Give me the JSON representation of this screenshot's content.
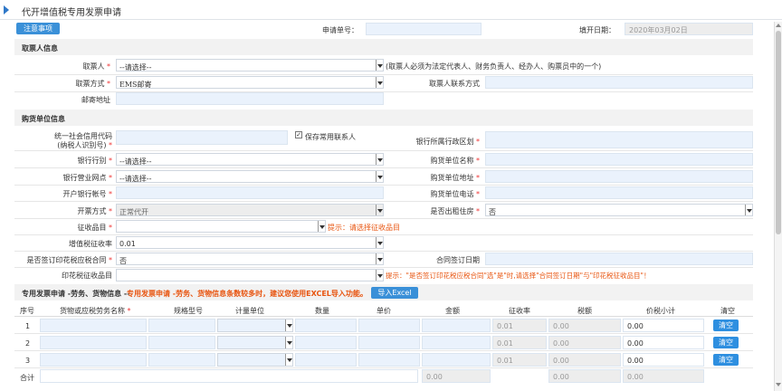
{
  "page": {
    "title": "代开增值税专用发票申请"
  },
  "toolbar": {
    "notice_button": "注意事项",
    "apply_no_label": "申请单号：",
    "apply_no_value": "",
    "fill_date_label": "填开日期：",
    "fill_date_value": "2020年03月02日"
  },
  "recipient": {
    "section": "取票人信息",
    "person_label": "取票人",
    "person_value": "--请选择--",
    "person_note": "(取票人必须为法定代表人、财务负责人、经办人、购票员中的一个)",
    "method_label": "取票方式",
    "method_value": "EMS邮寄",
    "contact_label": "取票人联系方式",
    "contact_value": "",
    "mail_label": "邮寄地址",
    "mail_value": ""
  },
  "buyer": {
    "section": "购货单位信息",
    "credit_label_1": "统一社会信用代码",
    "credit_label_2": "(纳税人识别号)",
    "save_contact": "保存常用联系人",
    "save_contact_checked": true,
    "bank_region_label": "银行所属行政区划",
    "bank_type_label": "银行行别",
    "bank_type_value": "--请选择--",
    "buyer_name_label": "购货单位名称",
    "outlet_label": "银行营业网点",
    "outlet_value": "--请选择--",
    "buyer_addr_label": "购货单位地址",
    "account_label": "开户银行帐号",
    "buyer_phone_label": "购货单位电话",
    "invoice_mode_label": "开票方式",
    "invoice_mode_value": "正常代开",
    "rent_label": "是否出租住房",
    "rent_value": "否",
    "levy_label": "征收品目",
    "levy_hint": "提示：请选择征收品目",
    "vat_rate_label": "增值税征收率",
    "vat_rate_value": "0.01",
    "stamp_contract_label": "是否签订印花税应税合同",
    "stamp_contract_value": "否",
    "contract_date_label": "合同签订日期",
    "stamp_levy_label": "印花税征收品目",
    "stamp_hint": "提示：\"是否签订印花税应税合同\"选\"是\"时,请选择\"合同签订日期\"与\"印花税征收品目\"！"
  },
  "goods": {
    "section_title": "专用发票申请 -劳务、货物信息 --",
    "section_hint": "专用发票申请 -劳务、货物信息条数较多时，建议您使用EXCEL导入功能。",
    "import_button": "导入Excel",
    "headers": [
      "序号",
      "货物或应税劳务名称",
      "规格型号",
      "计量单位",
      "数量",
      "单价",
      "金额",
      "征收率",
      "税额",
      "价税小计",
      "清空"
    ],
    "rows": [
      {
        "no": "1",
        "rate": "0.01",
        "tax": "0.00",
        "total": "0.00",
        "clear": "清空"
      },
      {
        "no": "2",
        "rate": "0.01",
        "tax": "0.00",
        "total": "0.00",
        "clear": "清空"
      },
      {
        "no": "3",
        "rate": "0.01",
        "tax": "0.00",
        "total": "0.00",
        "clear": "清空"
      }
    ],
    "sum_label": "合计",
    "sum_amount": "0.00",
    "sum_tax": "0.00",
    "sum_total": "0.00"
  }
}
